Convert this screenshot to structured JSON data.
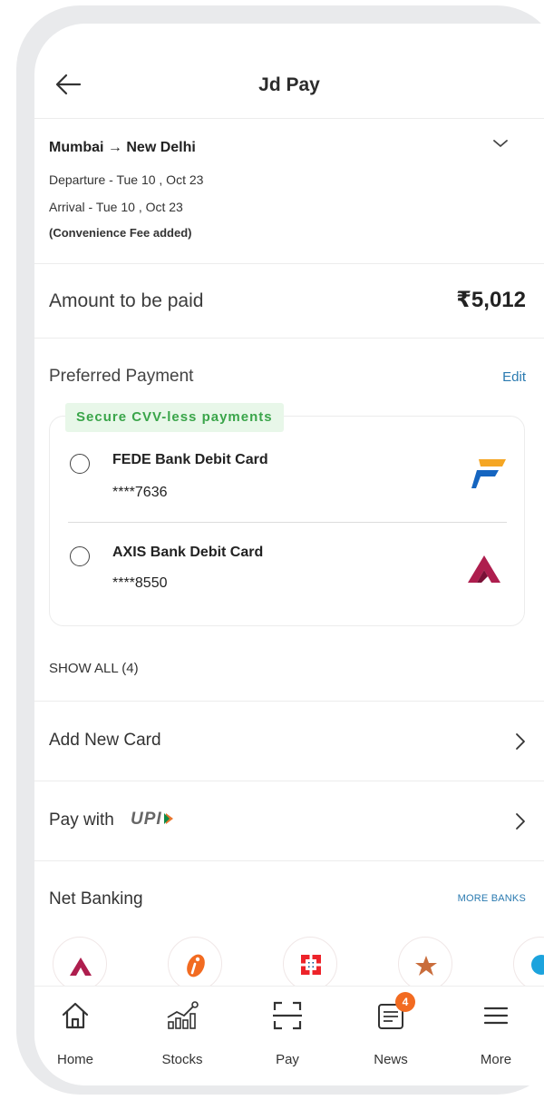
{
  "header": {
    "title": "Jd Pay"
  },
  "trip": {
    "route_from": "Mumbai",
    "route_arrow": "→",
    "route_to": "New Delhi",
    "departure": "Departure - Tue 10 , Oct 23",
    "arrival": "Arrival - Tue 10 , Oct 23",
    "fee_note": "(Convenience Fee added)"
  },
  "amount": {
    "label": "Amount to be paid",
    "value": "₹5,012"
  },
  "preferred": {
    "label": "Preferred Payment",
    "edit": "Edit",
    "badge": "Secure CVV-less payments",
    "cards": [
      {
        "name": "FEDE Bank Debit Card",
        "number": "****7636",
        "logo": "federal-bank-logo",
        "color": "#1565c0"
      },
      {
        "name": "AXIS Bank Debit Card",
        "number": "****8550",
        "logo": "axis-bank-logo",
        "color": "#ae1e4e"
      }
    ]
  },
  "show_all": "SHOW ALL (4)",
  "add_card": {
    "label": "Add New Card"
  },
  "upi": {
    "label": "Pay with",
    "logo_text": "UPI"
  },
  "net_banking": {
    "label": "Net Banking",
    "more": "MORE BANKS",
    "banks": [
      "axis-bank-icon",
      "icici-bank-icon",
      "hdfc-bank-icon",
      "kotak-bank-icon",
      "other-bank-icon"
    ]
  },
  "tabs": [
    {
      "label": "Home",
      "icon": "home-icon"
    },
    {
      "label": "Stocks",
      "icon": "stocks-icon"
    },
    {
      "label": "Pay",
      "icon": "scan-icon"
    },
    {
      "label": "News",
      "icon": "news-icon",
      "badge": "4"
    },
    {
      "label": "More",
      "icon": "menu-icon"
    }
  ],
  "colors": {
    "accent_link": "#2a7ab0",
    "badge_green": "#3aa54a",
    "news_badge": "#f26b21"
  }
}
